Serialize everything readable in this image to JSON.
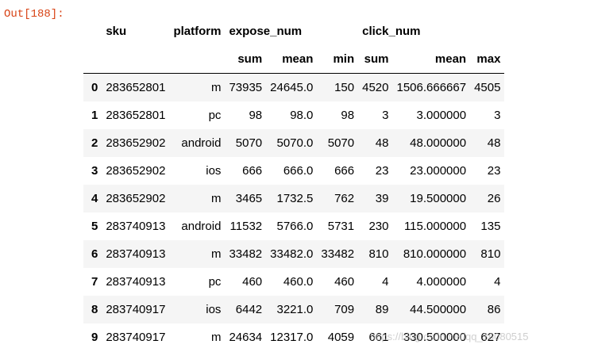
{
  "prompt": "Out[188]:",
  "headers": {
    "level0": [
      "sku",
      "platform",
      "expose_num",
      "click_num"
    ],
    "level1": [
      "sum",
      "mean",
      "min",
      "sum",
      "mean",
      "max"
    ]
  },
  "rows": [
    {
      "index": "0",
      "sku": "283652801",
      "platform": "m",
      "expose_sum": "73935",
      "expose_mean": "24645.0",
      "expose_min": "150",
      "click_sum": "4520",
      "click_mean": "1506.666667",
      "click_max": "4505"
    },
    {
      "index": "1",
      "sku": "283652801",
      "platform": "pc",
      "expose_sum": "98",
      "expose_mean": "98.0",
      "expose_min": "98",
      "click_sum": "3",
      "click_mean": "3.000000",
      "click_max": "3"
    },
    {
      "index": "2",
      "sku": "283652902",
      "platform": "android",
      "expose_sum": "5070",
      "expose_mean": "5070.0",
      "expose_min": "5070",
      "click_sum": "48",
      "click_mean": "48.000000",
      "click_max": "48"
    },
    {
      "index": "3",
      "sku": "283652902",
      "platform": "ios",
      "expose_sum": "666",
      "expose_mean": "666.0",
      "expose_min": "666",
      "click_sum": "23",
      "click_mean": "23.000000",
      "click_max": "23"
    },
    {
      "index": "4",
      "sku": "283652902",
      "platform": "m",
      "expose_sum": "3465",
      "expose_mean": "1732.5",
      "expose_min": "762",
      "click_sum": "39",
      "click_mean": "19.500000",
      "click_max": "26"
    },
    {
      "index": "5",
      "sku": "283740913",
      "platform": "android",
      "expose_sum": "11532",
      "expose_mean": "5766.0",
      "expose_min": "5731",
      "click_sum": "230",
      "click_mean": "115.000000",
      "click_max": "135"
    },
    {
      "index": "6",
      "sku": "283740913",
      "platform": "m",
      "expose_sum": "33482",
      "expose_mean": "33482.0",
      "expose_min": "33482",
      "click_sum": "810",
      "click_mean": "810.000000",
      "click_max": "810"
    },
    {
      "index": "7",
      "sku": "283740913",
      "platform": "pc",
      "expose_sum": "460",
      "expose_mean": "460.0",
      "expose_min": "460",
      "click_sum": "4",
      "click_mean": "4.000000",
      "click_max": "4"
    },
    {
      "index": "8",
      "sku": "283740917",
      "platform": "ios",
      "expose_sum": "6442",
      "expose_mean": "3221.0",
      "expose_min": "709",
      "click_sum": "89",
      "click_mean": "44.500000",
      "click_max": "86"
    },
    {
      "index": "9",
      "sku": "283740917",
      "platform": "m",
      "expose_sum": "24634",
      "expose_mean": "12317.0",
      "expose_min": "4059",
      "click_sum": "661",
      "click_mean": "330.500000",
      "click_max": "627"
    }
  ],
  "watermark": "https://blog.csdn.net/qq_36080515"
}
